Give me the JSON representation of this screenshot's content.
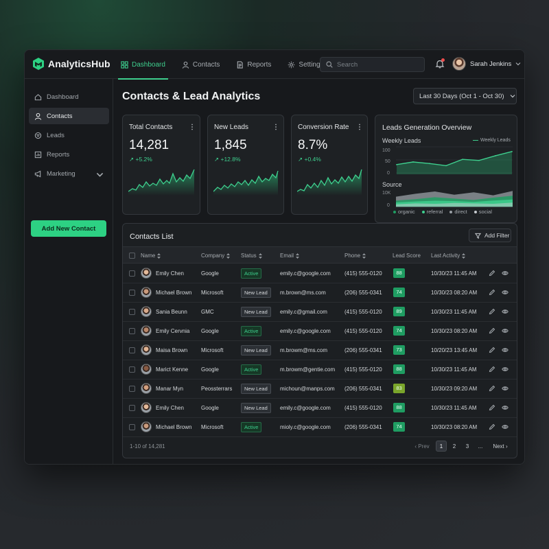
{
  "app": {
    "name": "AnalyticsHub"
  },
  "nav": [
    {
      "label": "Dashboard",
      "icon": "grid-icon",
      "active": true
    },
    {
      "label": "Contacts",
      "icon": "user-icon"
    },
    {
      "label": "Reports",
      "icon": "document-icon"
    },
    {
      "label": "Settings",
      "icon": "gear-icon"
    }
  ],
  "search": {
    "placeholder": "Search"
  },
  "user": {
    "name": "Sarah Jenkins"
  },
  "sidebar": {
    "items": [
      {
        "label": "Dashboard",
        "icon": "home-icon"
      },
      {
        "label": "Contacts",
        "icon": "user-icon",
        "active": true
      },
      {
        "label": "Leads",
        "icon": "funnel-icon"
      },
      {
        "label": "Reports",
        "icon": "chart-icon"
      },
      {
        "label": "Marketing",
        "icon": "megaphone-icon"
      }
    ],
    "add_button": "Add New Contact"
  },
  "page": {
    "title": "Contacts & Lead Analytics",
    "range": "Last 30 Days (Oct 1 - Oct 30)"
  },
  "cards": [
    {
      "title": "Total Contacts",
      "value": "14,281",
      "delta": "↗ +5.2%"
    },
    {
      "title": "New Leads",
      "value": "1,845",
      "delta": "↗ +12.8%"
    },
    {
      "title": "Conversion Rate",
      "value": "8.7%",
      "delta": "↗ +0.4%"
    }
  ],
  "overview": {
    "title": "Leads Generation Overview",
    "weekly_title": "Weekly Leads",
    "weekly_legend": "Weekly Leads",
    "weekly_ticks": [
      "100",
      "50",
      "0"
    ],
    "source_title": "Source",
    "source_ticks": [
      "10K",
      "0"
    ],
    "source_legend": [
      "organic",
      "referral",
      "direct",
      "social"
    ]
  },
  "chart_data": [
    {
      "type": "line",
      "title": "Weekly Leads",
      "ylim": [
        0,
        100
      ],
      "series": [
        {
          "name": "Weekly Leads",
          "values": [
            32,
            42,
            36,
            28,
            52,
            48,
            66,
            82
          ]
        }
      ]
    },
    {
      "type": "area",
      "title": "Source",
      "ylim": [
        0,
        10000
      ],
      "series": [
        {
          "name": "organic",
          "values": [
            3500,
            4200,
            5200,
            4500,
            3800,
            5000,
            6000
          ]
        },
        {
          "name": "referral",
          "values": [
            2500,
            3000,
            3400,
            3200,
            2800,
            3500,
            4000
          ]
        },
        {
          "name": "direct",
          "values": [
            5500,
            7000,
            8200,
            6500,
            7800,
            6200,
            8500
          ]
        },
        {
          "name": "social",
          "values": [
            1500,
            2000,
            1800,
            2200,
            2000,
            1800,
            2400
          ]
        }
      ]
    }
  ],
  "table": {
    "title": "Contacts List",
    "filter_label": "Add Filter",
    "headers": [
      "Name",
      "Company",
      "Status",
      "Email",
      "Phone",
      "Lead Score",
      "Last Activity"
    ],
    "rows": [
      {
        "name": "Emily Chen",
        "company": "Google",
        "status": "Active",
        "email": "emily.c@google.com",
        "phone": "(415) 555-0120",
        "score": "88",
        "activity": "10/30/23 11:45 AM"
      },
      {
        "name": "Michael Brown",
        "company": "Microsoft",
        "status": "New Lead",
        "email": "m.brown@ms.com",
        "phone": "(206) 555-0341",
        "score": "74",
        "activity": "10/30/23 08:20 AM"
      },
      {
        "name": "Sania Beunn",
        "company": "GMC",
        "status": "New Lead",
        "email": "emily.c@gmail.com",
        "phone": "(415) 555-0120",
        "score": "89",
        "activity": "10/30/23 11:45 AM"
      },
      {
        "name": "Emily Cervnia",
        "company": "Google",
        "status": "Active",
        "email": "emily.c@google.com",
        "phone": "(415) 555-0120",
        "score": "74",
        "activity": "10/30/23 08:20 AM"
      },
      {
        "name": "Maisa Brown",
        "company": "Microsoft",
        "status": "New Lead",
        "email": "m.browm@ms.com",
        "phone": "(206) 555-0341",
        "score": "73",
        "activity": "10/20/23 13:45 AM"
      },
      {
        "name": "Marict Kenne",
        "company": "Google",
        "status": "Active",
        "email": "m.browm@gentie.com",
        "phone": "(415) 555-0120",
        "score": "88",
        "activity": "10/30/23 11:45 AM"
      },
      {
        "name": "Manar Myn",
        "company": "Peossterrars",
        "status": "New Lead",
        "email": "michoun@manps.com",
        "phone": "(206) 555-0341",
        "score": "83",
        "activity": "10/30/23 09:20 AM"
      },
      {
        "name": "Emily Chen",
        "company": "Google",
        "status": "New Lead",
        "email": "emily.c@google.com",
        "phone": "(415) 555-0120",
        "score": "88",
        "activity": "10/30/23 11:45 AM"
      },
      {
        "name": "Michael Brown",
        "company": "Microsoft",
        "status": "Active",
        "email": "mioly.c@google.com",
        "phone": "(206) 555-0341",
        "score": "74",
        "activity": "10/30/23 08:20 AM"
      }
    ],
    "footer": "1-10 of 14,281",
    "pager": {
      "prev": "Prev",
      "pages": [
        "1",
        "2",
        "3",
        "..."
      ],
      "next": "Next"
    }
  },
  "colors": {
    "accent": "#3ecf8e",
    "accent_dark": "#1f9d62",
    "score_alt": "#7aa52b",
    "background": "#17191c"
  }
}
